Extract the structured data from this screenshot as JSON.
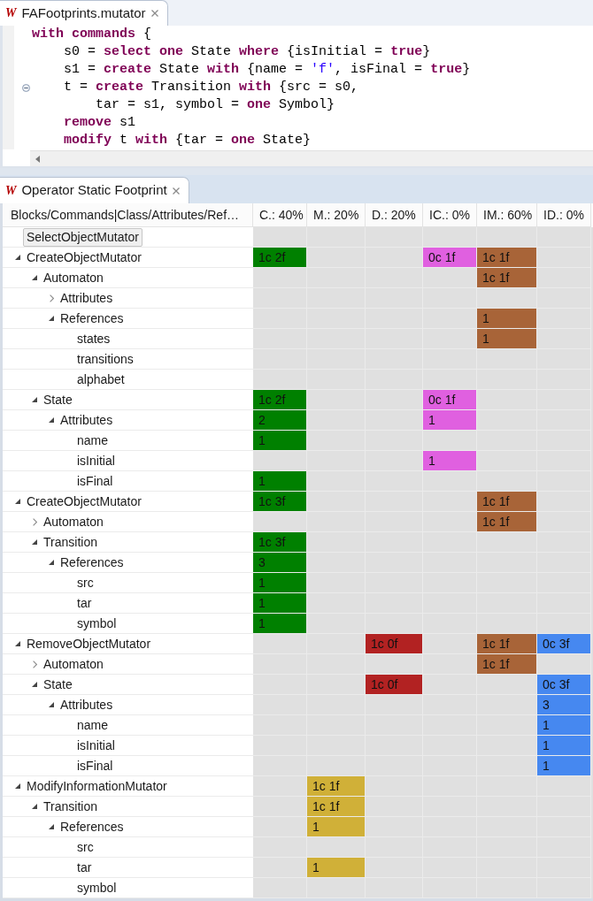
{
  "editor": {
    "tab": {
      "logo": "W",
      "title": "FAFootprints.mutator",
      "selected": true
    },
    "lines": [
      {
        "tokens": [
          {
            "kind": "keyword",
            "text": "with"
          },
          {
            "kind": "keyword",
            "text": " commands"
          },
          {
            "kind": "plain",
            "text": " {"
          }
        ]
      },
      {
        "tokens": [
          {
            "kind": "plain",
            "text": "    s0 = "
          },
          {
            "kind": "keyword",
            "text": "select"
          },
          {
            "kind": "keyword",
            "text": " one"
          },
          {
            "kind": "plain",
            "text": " State "
          },
          {
            "kind": "keyword",
            "text": "where"
          },
          {
            "kind": "plain",
            "text": " {isInitial = "
          },
          {
            "kind": "keyword",
            "text": "true"
          },
          {
            "kind": "plain",
            "text": "}"
          }
        ]
      },
      {
        "tokens": [
          {
            "kind": "plain",
            "text": "    s1 = "
          },
          {
            "kind": "keyword",
            "text": "create"
          },
          {
            "kind": "plain",
            "text": " State "
          },
          {
            "kind": "keyword",
            "text": "with"
          },
          {
            "kind": "plain",
            "text": " {name = "
          },
          {
            "kind": "string",
            "text": "'f'"
          },
          {
            "kind": "plain",
            "text": ", isFinal = "
          },
          {
            "kind": "keyword",
            "text": "true"
          },
          {
            "kind": "plain",
            "text": "}"
          }
        ]
      },
      {
        "folded": false,
        "tokens": [
          {
            "kind": "plain",
            "text": "    t = "
          },
          {
            "kind": "keyword",
            "text": "create"
          },
          {
            "kind": "plain",
            "text": " Transition "
          },
          {
            "kind": "keyword",
            "text": "with"
          },
          {
            "kind": "plain",
            "text": " {src = s0,"
          }
        ]
      },
      {
        "tokens": [
          {
            "kind": "plain",
            "text": "        tar = s1, symbol = "
          },
          {
            "kind": "keyword",
            "text": "one"
          },
          {
            "kind": "plain",
            "text": " Symbol}"
          }
        ]
      },
      {
        "tokens": [
          {
            "kind": "keyword",
            "text": "    remove"
          },
          {
            "kind": "plain",
            "text": " s1"
          }
        ]
      },
      {
        "tokens": [
          {
            "kind": "keyword",
            "text": "    modify"
          },
          {
            "kind": "plain",
            "text": " t "
          },
          {
            "kind": "keyword",
            "text": "with"
          },
          {
            "kind": "plain",
            "text": " {tar = "
          },
          {
            "kind": "keyword",
            "text": "one"
          },
          {
            "kind": "plain",
            "text": " State}"
          }
        ]
      }
    ]
  },
  "view": {
    "tab": {
      "logo": "W",
      "title": "Operator Static Footprint",
      "selected": true
    }
  },
  "table": {
    "tree_column": {
      "label": "Blocks/Commands|Class/Attributes/Ref…"
    },
    "columns": [
      {
        "label": "C.: 40%",
        "color": "#008000"
      },
      {
        "label": "M.: 20%",
        "color": "#d0b038"
      },
      {
        "label": "D.: 20%",
        "color": "#b22222"
      },
      {
        "label": "IC.: 0%",
        "color": "#e060e0"
      },
      {
        "label": "IM.: 60%",
        "color": "#a86438"
      },
      {
        "label": "ID.: 0%",
        "color": "#4688f0"
      }
    ],
    "rows": [
      {
        "label": "SelectObjectMutator",
        "selected": true,
        "cells": [
          null,
          null,
          null,
          null,
          null,
          null
        ]
      },
      {
        "label": "CreateObjectMutator",
        "selected": false,
        "expanded": true,
        "cells": [
          "1c 2f",
          null,
          null,
          "0c 1f",
          "1c 1f",
          null
        ],
        "children": [
          {
            "label": "Automaton",
            "selected": false,
            "expanded": true,
            "cells": [
              null,
              null,
              null,
              null,
              "1c 1f",
              null
            ],
            "children": [
              {
                "label": "Attributes",
                "selected": false,
                "expanded": false,
                "cells": [
                  null,
                  null,
                  null,
                  null,
                  null,
                  null
                ]
              },
              {
                "label": "References",
                "selected": false,
                "expanded": true,
                "cells": [
                  null,
                  null,
                  null,
                  null,
                  "1",
                  null
                ],
                "children": [
                  {
                    "label": "states",
                    "selected": false,
                    "cells": [
                      null,
                      null,
                      null,
                      null,
                      "1",
                      null
                    ]
                  },
                  {
                    "label": "transitions",
                    "selected": false,
                    "cells": [
                      null,
                      null,
                      null,
                      null,
                      null,
                      null
                    ]
                  },
                  {
                    "label": "alphabet",
                    "selected": false,
                    "cells": [
                      null,
                      null,
                      null,
                      null,
                      null,
                      null
                    ]
                  }
                ]
              }
            ]
          },
          {
            "label": "State",
            "selected": false,
            "expanded": true,
            "cells": [
              "1c 2f",
              null,
              null,
              "0c 1f",
              null,
              null
            ],
            "children": [
              {
                "label": "Attributes",
                "selected": false,
                "expanded": true,
                "cells": [
                  "2",
                  null,
                  null,
                  "1",
                  null,
                  null
                ],
                "children": [
                  {
                    "label": "name",
                    "selected": false,
                    "cells": [
                      "1",
                      null,
                      null,
                      null,
                      null,
                      null
                    ]
                  },
                  {
                    "label": "isInitial",
                    "selected": false,
                    "cells": [
                      null,
                      null,
                      null,
                      "1",
                      null,
                      null
                    ]
                  },
                  {
                    "label": "isFinal",
                    "selected": false,
                    "cells": [
                      "1",
                      null,
                      null,
                      null,
                      null,
                      null
                    ]
                  }
                ]
              }
            ]
          }
        ]
      },
      {
        "label": "CreateObjectMutator",
        "selected": false,
        "expanded": true,
        "cells": [
          "1c 3f",
          null,
          null,
          null,
          "1c 1f",
          null
        ],
        "children": [
          {
            "label": "Automaton",
            "selected": false,
            "expanded": false,
            "cells": [
              null,
              null,
              null,
              null,
              "1c 1f",
              null
            ]
          },
          {
            "label": "Transition",
            "selected": false,
            "expanded": true,
            "cells": [
              "1c 3f",
              null,
              null,
              null,
              null,
              null
            ],
            "children": [
              {
                "label": "References",
                "selected": false,
                "expanded": true,
                "cells": [
                  "3",
                  null,
                  null,
                  null,
                  null,
                  null
                ],
                "children": [
                  {
                    "label": "src",
                    "selected": false,
                    "cells": [
                      "1",
                      null,
                      null,
                      null,
                      null,
                      null
                    ]
                  },
                  {
                    "label": "tar",
                    "selected": false,
                    "cells": [
                      "1",
                      null,
                      null,
                      null,
                      null,
                      null
                    ]
                  },
                  {
                    "label": "symbol",
                    "selected": false,
                    "cells": [
                      "1",
                      null,
                      null,
                      null,
                      null,
                      null
                    ]
                  }
                ]
              }
            ]
          }
        ]
      },
      {
        "label": "RemoveObjectMutator",
        "selected": false,
        "expanded": true,
        "cells": [
          null,
          null,
          "1c 0f",
          null,
          "1c 1f",
          "0c 3f"
        ],
        "children": [
          {
            "label": "Automaton",
            "selected": false,
            "expanded": false,
            "cells": [
              null,
              null,
              null,
              null,
              "1c 1f",
              null
            ]
          },
          {
            "label": "State",
            "selected": false,
            "expanded": true,
            "cells": [
              null,
              null,
              "1c 0f",
              null,
              null,
              "0c 3f"
            ],
            "children": [
              {
                "label": "Attributes",
                "selected": false,
                "expanded": true,
                "cells": [
                  null,
                  null,
                  null,
                  null,
                  null,
                  "3"
                ],
                "children": [
                  {
                    "label": "name",
                    "selected": false,
                    "cells": [
                      null,
                      null,
                      null,
                      null,
                      null,
                      "1"
                    ]
                  },
                  {
                    "label": "isInitial",
                    "selected": false,
                    "cells": [
                      null,
                      null,
                      null,
                      null,
                      null,
                      "1"
                    ]
                  },
                  {
                    "label": "isFinal",
                    "selected": false,
                    "cells": [
                      null,
                      null,
                      null,
                      null,
                      null,
                      "1"
                    ]
                  }
                ]
              }
            ]
          }
        ]
      },
      {
        "label": "ModifyInformationMutator",
        "selected": false,
        "expanded": true,
        "cells": [
          null,
          "1c 1f",
          null,
          null,
          null,
          null
        ],
        "children": [
          {
            "label": "Transition",
            "selected": false,
            "expanded": true,
            "cells": [
              null,
              "1c 1f",
              null,
              null,
              null,
              null
            ],
            "children": [
              {
                "label": "References",
                "selected": false,
                "expanded": true,
                "cells": [
                  null,
                  "1",
                  null,
                  null,
                  null,
                  null
                ],
                "children": [
                  {
                    "label": "src",
                    "selected": false,
                    "cells": [
                      null,
                      null,
                      null,
                      null,
                      null,
                      null
                    ]
                  },
                  {
                    "label": "tar",
                    "selected": false,
                    "cells": [
                      null,
                      "1",
                      null,
                      null,
                      null,
                      null
                    ]
                  },
                  {
                    "label": "symbol",
                    "selected": false,
                    "cells": [
                      null,
                      null,
                      null,
                      null,
                      null,
                      null
                    ]
                  }
                ]
              }
            ]
          }
        ]
      }
    ]
  }
}
